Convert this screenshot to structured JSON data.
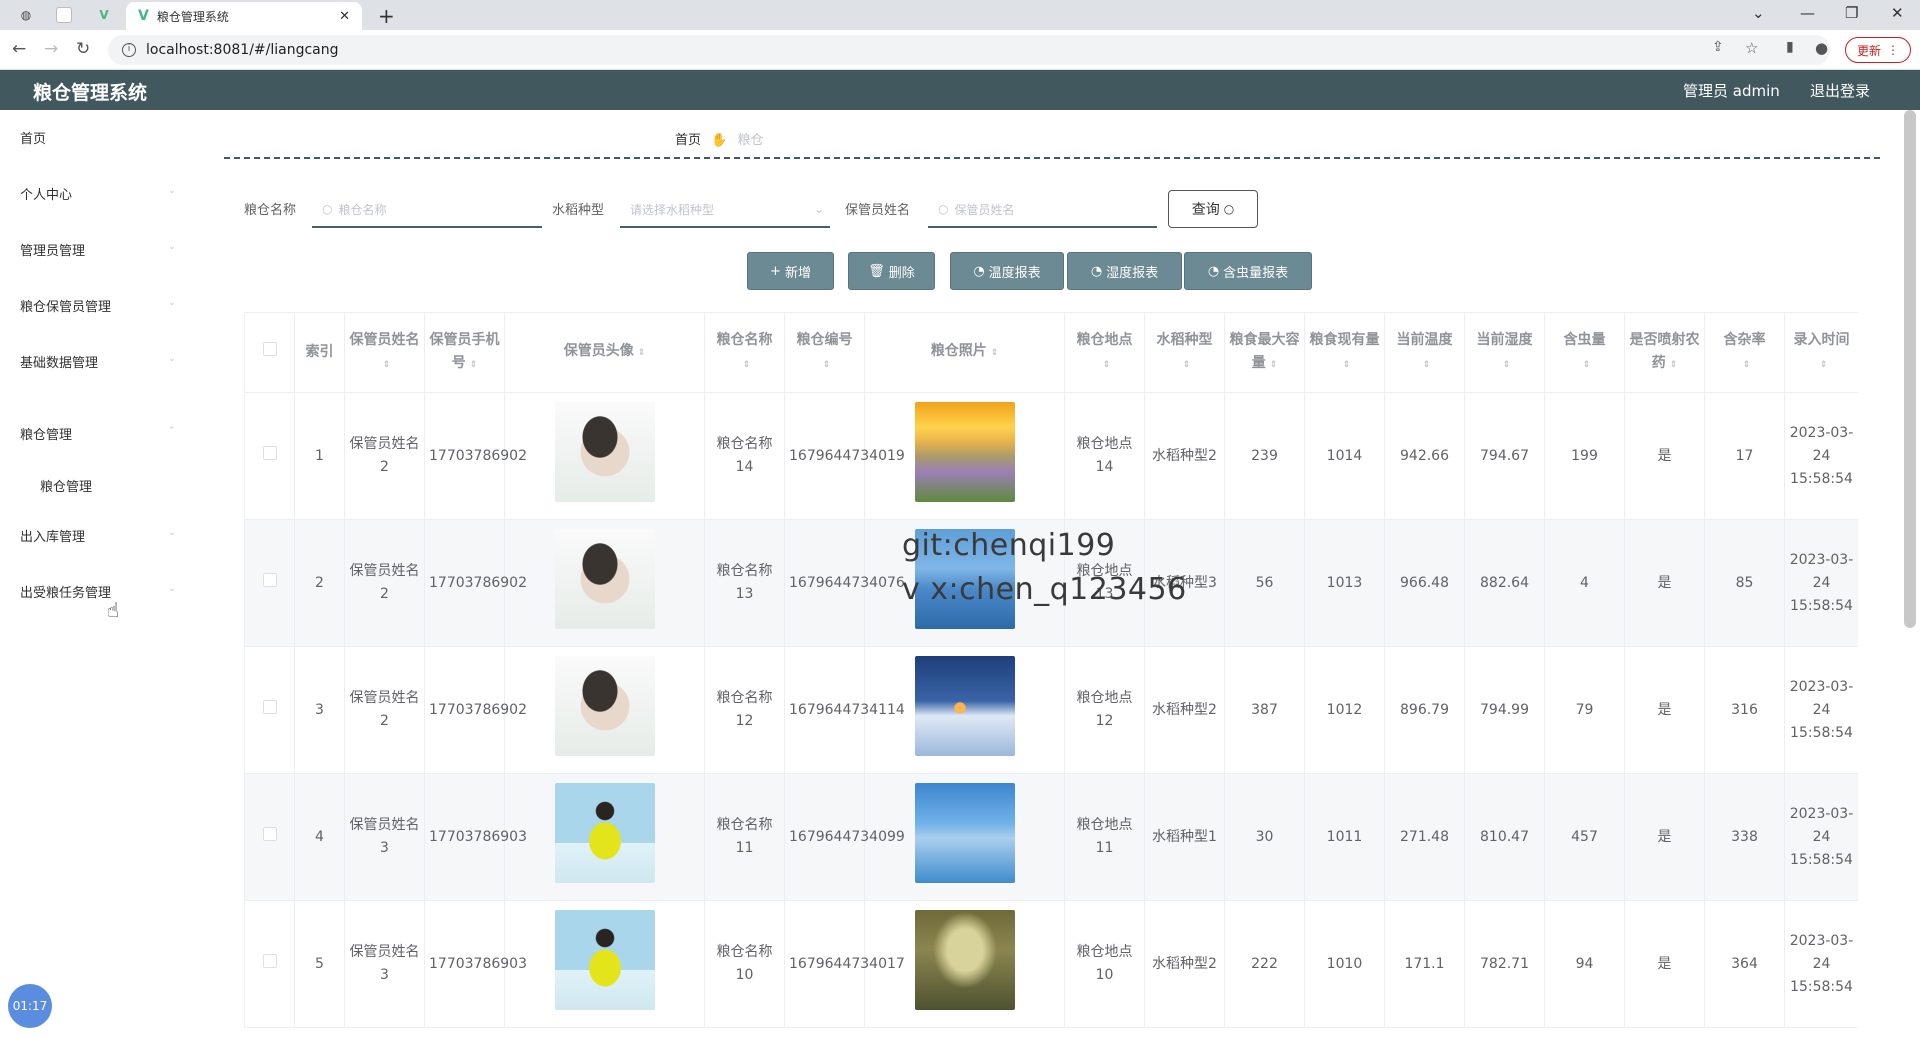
{
  "browser": {
    "tab_title": "粮仓管理系统",
    "url": "localhost:8081/#/liangcang",
    "update_label": "更新"
  },
  "header": {
    "app_title": "粮仓管理系统",
    "user_label": "管理员 admin",
    "logout_label": "退出登录"
  },
  "sidebar": {
    "items": [
      {
        "label": "首页"
      },
      {
        "label": "个人中心"
      },
      {
        "label": "管理员管理"
      },
      {
        "label": "粮仓保管员管理"
      },
      {
        "label": "基础数据管理"
      },
      {
        "label": "粮仓管理"
      },
      {
        "label": "粮仓管理"
      },
      {
        "label": "出入库管理"
      },
      {
        "label": "出受粮任务管理"
      }
    ]
  },
  "breadcrumb": {
    "home": "首页",
    "current": "粮仓"
  },
  "search": {
    "name_label": "粮仓名称",
    "name_placeholder": "粮仓名称",
    "type_label": "水稻种型",
    "type_placeholder": "请选择水稻种型",
    "keeper_label": "保管员姓名",
    "keeper_placeholder": "保管员姓名",
    "query_label": "查询"
  },
  "actions": {
    "add": "新增",
    "delete": "删除",
    "temp_report": "温度报表",
    "humidity_report": "湿度报表",
    "insect_report": "含虫量报表"
  },
  "table": {
    "headers": [
      "索引",
      "保管员姓名",
      "保管员手机号",
      "保管员头像",
      "粮仓名称",
      "粮仓编号",
      "粮仓照片",
      "粮仓地点",
      "水稻种型",
      "粮食最大容量",
      "粮食现有量",
      "当前温度",
      "当前湿度",
      "含虫量",
      "是否喷射农药",
      "含杂率",
      "录入时间"
    ],
    "rows": [
      {
        "index": "1",
        "keeper": "保管员姓名2",
        "phone": "17703786902",
        "name": "粮仓名称14",
        "code": "1679644734019",
        "place": "粮仓地点14",
        "type": "水稻种型2",
        "max": "239",
        "current": "1014",
        "temp": "942.66",
        "humidity": "794.67",
        "insect": "199",
        "pesticide": "是",
        "impurity": "17",
        "time": "2023-03-24 15:58:54"
      },
      {
        "index": "2",
        "keeper": "保管员姓名2",
        "phone": "17703786902",
        "name": "粮仓名称13",
        "code": "1679644734076",
        "place": "粮仓地点13",
        "type": "水稻种型3",
        "max": "56",
        "current": "1013",
        "temp": "966.48",
        "humidity": "882.64",
        "insect": "4",
        "pesticide": "是",
        "impurity": "85",
        "time": "2023-03-24 15:58:54"
      },
      {
        "index": "3",
        "keeper": "保管员姓名2",
        "phone": "17703786902",
        "name": "粮仓名称12",
        "code": "1679644734114",
        "place": "粮仓地点12",
        "type": "水稻种型2",
        "max": "387",
        "current": "1012",
        "temp": "896.79",
        "humidity": "794.99",
        "insect": "79",
        "pesticide": "是",
        "impurity": "316",
        "time": "2023-03-24 15:58:54"
      },
      {
        "index": "4",
        "keeper": "保管员姓名3",
        "phone": "17703786903",
        "name": "粮仓名称11",
        "code": "1679644734099",
        "place": "粮仓地点11",
        "type": "水稻种型1",
        "max": "30",
        "current": "1011",
        "temp": "271.48",
        "humidity": "810.47",
        "insect": "457",
        "pesticide": "是",
        "impurity": "338",
        "time": "2023-03-24 15:58:54"
      },
      {
        "index": "5",
        "keeper": "保管员姓名3",
        "phone": "17703786903",
        "name": "粮仓名称10",
        "code": "1679644734017",
        "place": "粮仓地点10",
        "type": "水稻种型2",
        "max": "222",
        "current": "1010",
        "temp": "171.1",
        "humidity": "782.71",
        "insect": "94",
        "pesticide": "是",
        "impurity": "364",
        "time": "2023-03-24 15:58:54"
      }
    ]
  },
  "watermark": {
    "line1": "git:chenqi199",
    "line2": "v x:chen_q123456"
  },
  "timer": "01:17",
  "colors": {
    "header_bg": "#41585f",
    "button_bg": "#6b8a93"
  }
}
